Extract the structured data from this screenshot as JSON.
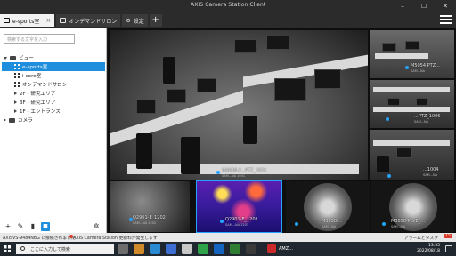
{
  "window": {
    "title": "AXIS Camera Station Client",
    "controls": [
      "–",
      "☐",
      "✕"
    ]
  },
  "tabs": [
    {
      "label": "e-sports室",
      "active": true
    },
    {
      "label": "オンデマンドサロン",
      "active": false
    },
    {
      "label": "設定",
      "active": false
    }
  ],
  "sidebar": {
    "search_placeholder": "検索する文字を入力",
    "tree": {
      "root_views": "ビュー",
      "views": [
        {
          "label": "e-sports室",
          "selected": true
        },
        {
          "label": "i-core室"
        },
        {
          "label": "オンデマンドサロン"
        },
        {
          "label": "2F - 研究エリア"
        },
        {
          "label": "3F - 研究エリア"
        },
        {
          "label": "1F - エントランス"
        }
      ],
      "root_cameras": "カメラ"
    },
    "toolbar": {
      "add": "+",
      "edit": "✎",
      "delete": "🗑",
      "lock": "🔒",
      "settings": "✲"
    }
  },
  "cameras": {
    "main": {
      "label": "M4048-P...PTZ_1031",
      "sub": "SAM...NA 1031"
    },
    "right_top": {
      "label": "M5054 PTZ...",
      "sub": "SAM...NA"
    },
    "right_mid": {
      "label": "...PTZ_1006",
      "sub": "SAM...NA"
    },
    "right_bottom": {
      "label": "...1004",
      "sub": "SAM...NA"
    },
    "bottom_1": {
      "label": "Q2901-E_1202",
      "sub": "SAM...NA 1202"
    },
    "bottom_2": {
      "label": "Q2901-E_1201",
      "sub": "SAM...NA 1201"
    },
    "bottom_3": {
      "label": "M3058-...",
      "sub": "SAM...NA"
    },
    "bottom_4": {
      "label": "M3058-PLVE_...",
      "sub": "SAM...NA"
    }
  },
  "statusbar": {
    "left": "AXISVS-9484NBG に接続されました",
    "message": "AXIS Camera Station 更新料が発生します",
    "right": "アラームとタスク",
    "count": "15"
  },
  "taskbar": {
    "search_placeholder": "ここに入力して検索",
    "amz_label": "AMZ...",
    "time": "13:55",
    "date": "2022/08/18"
  },
  "colors": {
    "accent": "#1f8fdd",
    "alert": "#d93a2a",
    "thermal": "#5a1fb0"
  }
}
